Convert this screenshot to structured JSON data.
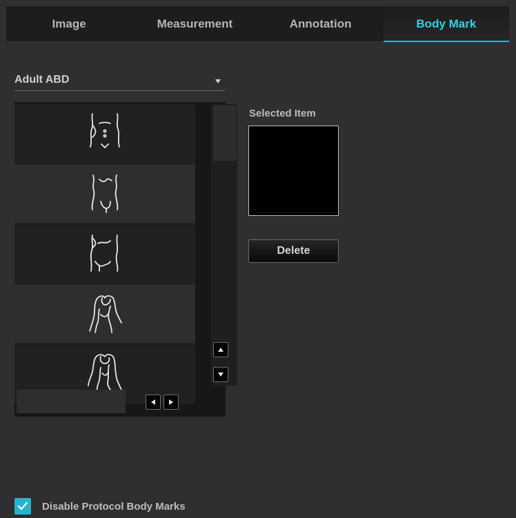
{
  "tabs": [
    {
      "label": "Image",
      "active": false
    },
    {
      "label": "Measurement",
      "active": false
    },
    {
      "label": "Annotation",
      "active": false
    },
    {
      "label": "Body Mark",
      "active": true
    }
  ],
  "category_dropdown": {
    "value": "Adult ABD"
  },
  "body_mark_list": {
    "items": [
      {
        "icon": "abdomen-front-icon"
      },
      {
        "icon": "abdomen-lower-icon"
      },
      {
        "icon": "abdomen-side-icon"
      },
      {
        "icon": "torso-oblique-left-icon"
      },
      {
        "icon": "torso-oblique-right-icon"
      }
    ]
  },
  "selected_item": {
    "label": "Selected Item"
  },
  "delete_button": {
    "label": "Delete"
  },
  "disable_protocol": {
    "label": "Disable Protocol Body Marks",
    "checked": true
  },
  "colors": {
    "background": "#2f2f2f",
    "tab_bar": "#1d1d1d",
    "accent": "#27d6e4",
    "checkbox": "#27b3cc"
  }
}
